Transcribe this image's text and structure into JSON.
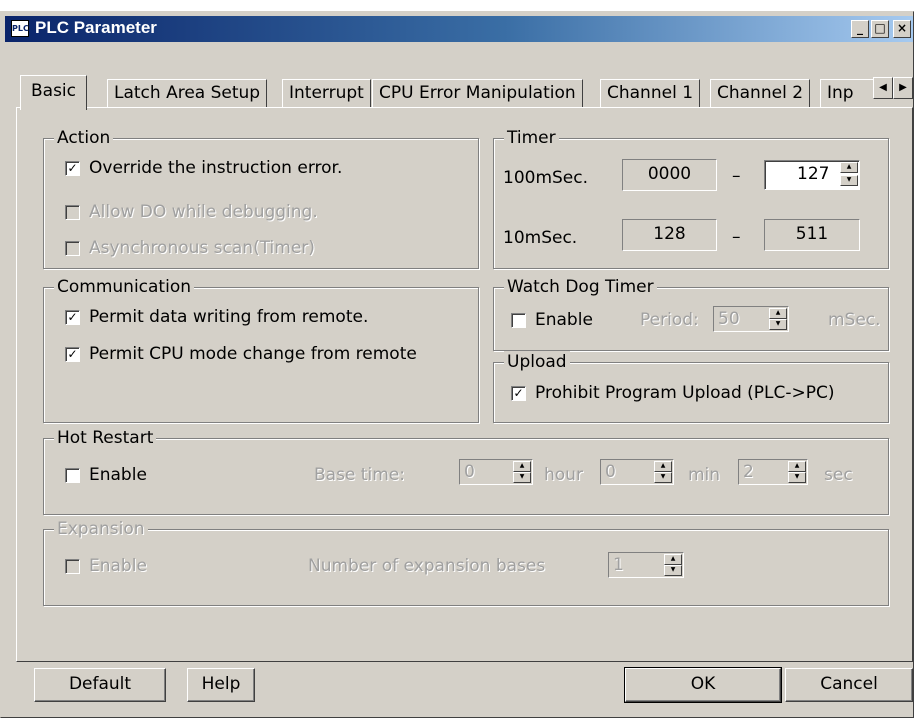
{
  "window": {
    "title": "PLC Parameter",
    "icon": "plc-app-icon",
    "controls": {
      "minimize": "_",
      "maximize": "□",
      "close": "×"
    }
  },
  "tabs": [
    {
      "label": "Basic",
      "active": true
    },
    {
      "label": "Latch Area Setup"
    },
    {
      "label": "Interrupt"
    },
    {
      "label": "CPU Error Manipulation"
    },
    {
      "label": "Channel 1"
    },
    {
      "label": "Channel 2"
    },
    {
      "label": "Inp"
    }
  ],
  "tab_scroll": {
    "left": "◀",
    "right": "▶"
  },
  "action": {
    "legend": "Action",
    "override": {
      "label": "Override the instruction error.",
      "checked": "✓"
    },
    "allow_do": {
      "label": "Allow DO while debugging.",
      "checked": ""
    },
    "async": {
      "label": "Asynchronous scan(Timer)",
      "checked": ""
    }
  },
  "timer": {
    "legend": "Timer",
    "row100": {
      "label": "100mSec.",
      "from": "0000",
      "dash": "–",
      "to": "127"
    },
    "row10": {
      "label": "10mSec.",
      "from": "128",
      "dash": "–",
      "to": "511"
    }
  },
  "communication": {
    "legend": "Communication",
    "permit_write": {
      "label": "Permit data writing from remote.",
      "checked": "✓"
    },
    "permit_mode": {
      "label": "Permit CPU mode change from remote",
      "checked": "✓"
    }
  },
  "watchdog": {
    "legend": "Watch Dog Timer",
    "enable": {
      "label": "Enable",
      "checked": ""
    },
    "period_label": "Period:",
    "period_value": "50",
    "unit": "mSec."
  },
  "upload": {
    "legend": "Upload",
    "prohibit": {
      "label": "Prohibit Program Upload (PLC->PC)",
      "checked": "✓"
    }
  },
  "hot_restart": {
    "legend": "Hot Restart",
    "enable": {
      "label": "Enable",
      "checked": ""
    },
    "base_time_label": "Base time:",
    "hour_value": "0",
    "hour_unit": "hour",
    "min_value": "0",
    "min_unit": "min",
    "sec_value": "2",
    "sec_unit": "sec"
  },
  "expansion": {
    "legend": "Expansion",
    "enable": {
      "label": "Enable",
      "checked": ""
    },
    "bases_label": "Number of expansion bases",
    "bases_value": "1"
  },
  "buttons": {
    "default": "Default",
    "help": "Help",
    "ok": "OK",
    "cancel": "Cancel"
  }
}
